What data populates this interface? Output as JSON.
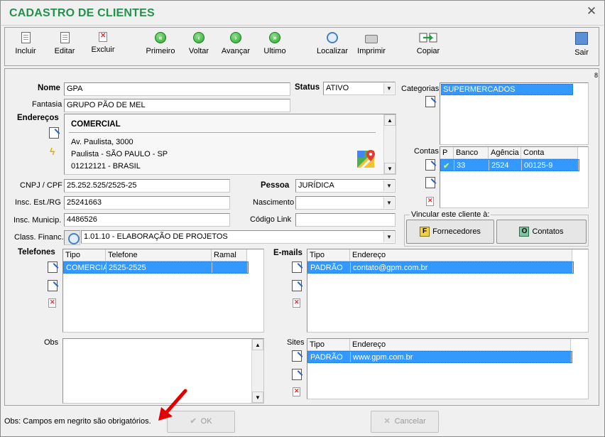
{
  "window": {
    "title": "CADASTRO DE CLIENTES",
    "close_symbol": "✕"
  },
  "toolbar": {
    "incluir": "Incluir",
    "editar": "Editar",
    "excluir": "Excluir",
    "primeiro": "Primeiro",
    "voltar": "Voltar",
    "avancar": "Avançar",
    "ultimo": "Ultimo",
    "localizar": "Localizar",
    "imprimir": "Imprimir",
    "copiar": "Copiar",
    "sair": "Sair"
  },
  "panel_marker": "8",
  "form": {
    "nome_label": "Nome",
    "nome_value": "GPA",
    "fantasia_label": "Fantasia",
    "fantasia_value": "GRUPO PÃO DE MEL",
    "status_label": "Status",
    "status_value": "ATIVO",
    "enderecos_label": "Endereços",
    "address": {
      "type": "COMERCIAL",
      "line1": "Av. Paulista, 3000",
      "line2": "Paulista - SÃO PAULO - SP",
      "line3": "01212121 - BRASIL"
    },
    "cnpj_label": "CNPJ / CPF",
    "cnpj_value": "25.252.525/2525-25",
    "insc_est_label": "Insc. Est./RG",
    "insc_est_value": "25241663",
    "insc_munic_label": "Insc. Municip.",
    "insc_munic_value": "4486526",
    "class_financ_label": "Class. Financ.",
    "class_financ_value": "1.01.10 - ELABORAÇÃO DE PROJETOS",
    "pessoa_label": "Pessoa",
    "pessoa_value": "JURÍDICA",
    "nascimento_label": "Nascimento",
    "nascimento_value": "",
    "codigo_link_label": "Código Link",
    "codigo_link_value": ""
  },
  "categorias": {
    "label": "Categorias",
    "items": [
      "SUPERMERCADOS"
    ]
  },
  "contas": {
    "label": "Contas",
    "headers": [
      "P",
      "Banco",
      "Agência",
      "Conta"
    ],
    "rows": [
      {
        "p": "✔",
        "banco": "33",
        "agencia": "2524",
        "conta": "00125-9"
      }
    ]
  },
  "vincular": {
    "title": "Vincular este cliente à:",
    "fornecedores": "Fornecedores",
    "fornecedores_icon": "F",
    "contatos": "Contatos",
    "contatos_icon": "O"
  },
  "telefones": {
    "label": "Telefones",
    "headers": [
      "Tipo",
      "Telefone",
      "Ramal"
    ],
    "rows": [
      {
        "tipo": "COMERCIA",
        "telefone": "2525-2525",
        "ramal": ""
      }
    ]
  },
  "emails": {
    "label": "E-mails",
    "headers": [
      "Tipo",
      "Endereço"
    ],
    "rows": [
      {
        "tipo": "PADRÃO",
        "endereco": "contato@gpm.com.br"
      }
    ]
  },
  "sites": {
    "label": "Sites",
    "headers": [
      "Tipo",
      "Endereço"
    ],
    "rows": [
      {
        "tipo": "PADRÃO",
        "endereco": "www.gpm.com.br"
      }
    ]
  },
  "obs": {
    "label": "Obs",
    "value": ""
  },
  "footer": {
    "note": "Obs: Campos em negrito são obrigatórios.",
    "ok_label": "OK",
    "cancel_label": "Cancelar"
  },
  "colors": {
    "title": "#22924b",
    "selection": "#3399ff",
    "annotation_arrow": "#e00000"
  }
}
